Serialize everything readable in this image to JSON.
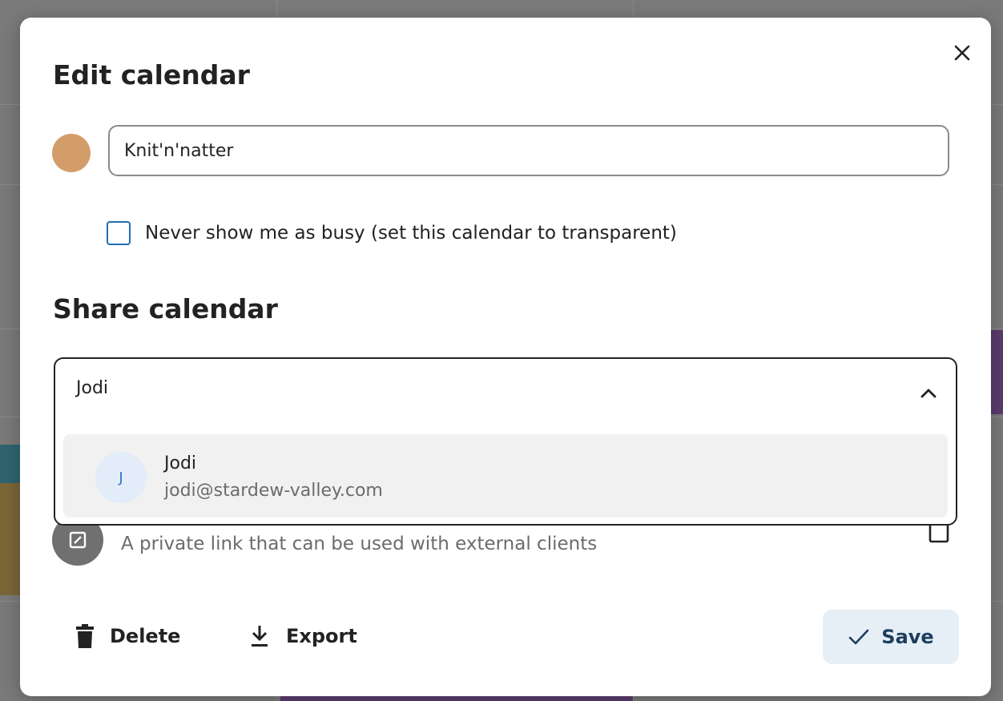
{
  "dialog": {
    "title": "Edit calendar",
    "close_label": "close"
  },
  "calendar": {
    "color": "#d39d6a",
    "name_value": "Knit'n'natter"
  },
  "transparency": {
    "label": "Never show me as busy (set this calendar to transparent)",
    "checked": false
  },
  "share": {
    "heading": "Share calendar",
    "search_value": "Jodi",
    "suggestions": [
      {
        "initial": "J",
        "name": "Jodi",
        "email": "jodi@stardew-valley.com"
      }
    ],
    "private_link_description": "A private link that can be used with external clients"
  },
  "footer": {
    "delete_label": "Delete",
    "export_label": "Export",
    "save_label": "Save"
  },
  "icons": {
    "close": "close-icon",
    "checkbox": "checkbox-icon",
    "chevron": "chevron-up-icon",
    "link": "link-icon",
    "copy": "copy-icon",
    "delete": "trash-icon",
    "export": "download-icon",
    "save": "checkmark-icon"
  }
}
